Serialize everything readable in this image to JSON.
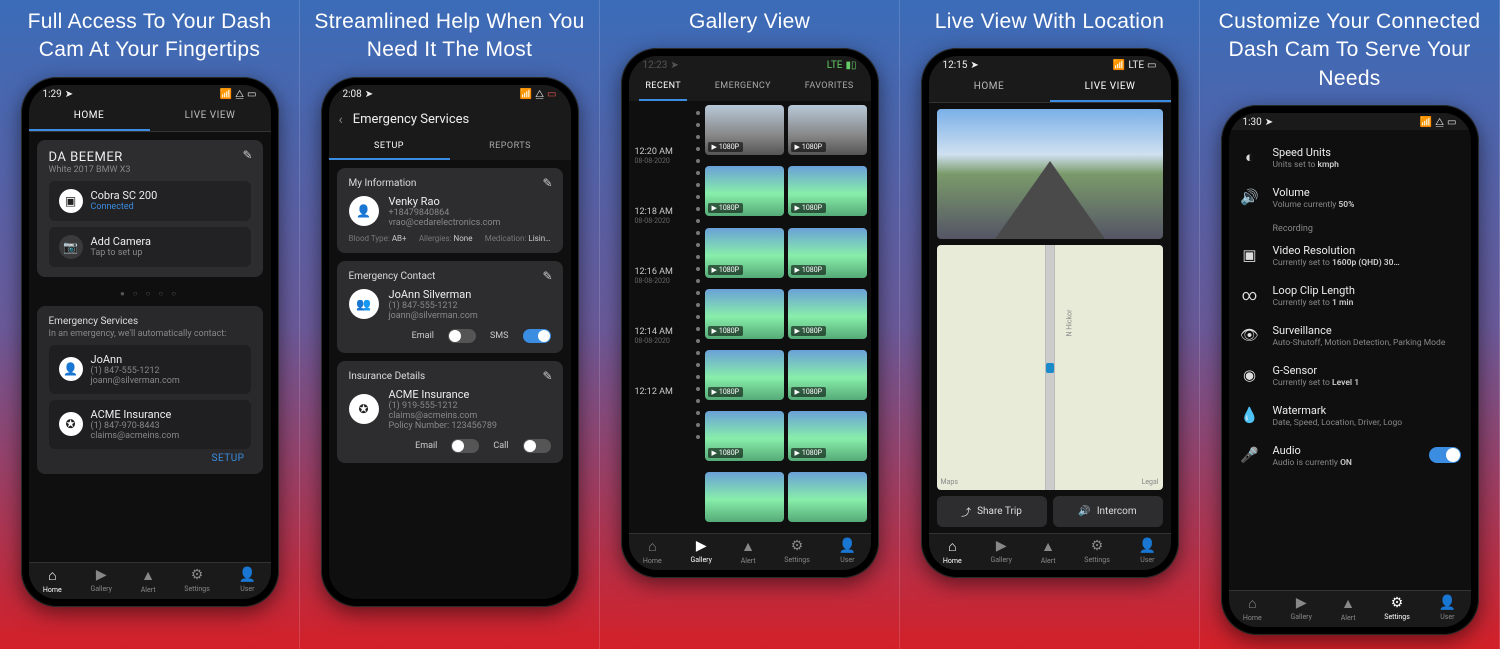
{
  "panels": [
    {
      "title": "Full Access To Your Dash Cam At Your Fingertips"
    },
    {
      "title": "Streamlined Help When You Need It The Most"
    },
    {
      "title": "Gallery View"
    },
    {
      "title": "Live View With Location"
    },
    {
      "title": "Customize Your Connected Dash Cam To Serve Your Needs"
    }
  ],
  "p1": {
    "time": "1:29",
    "tabs": {
      "home": "HOME",
      "live": "LIVE VIEW"
    },
    "vehicle": {
      "name": "DA BEEMER",
      "desc": "White 2017 BMW X3"
    },
    "cam": {
      "name": "Cobra SC 200",
      "status": "Connected"
    },
    "addcam": {
      "title": "Add Camera",
      "sub": "Tap to set up"
    },
    "emerg": {
      "title": "Emergency Services",
      "sub": "In an emergency, we'll automatically contact:",
      "contact1": {
        "name": "JoAnn",
        "phone": "(1) 847-555-1212",
        "email": "joann@silverman.com"
      },
      "contact2": {
        "name": "ACME Insurance",
        "phone": "(1) 847-970-8443",
        "email": "claims@acmeins.com"
      },
      "setup": "SETUP"
    }
  },
  "p2": {
    "time": "2:08",
    "header": "Emergency Services",
    "tabs": {
      "setup": "SETUP",
      "reports": "REPORTS"
    },
    "myinfo": {
      "title": "My Information",
      "name": "Venky Rao",
      "phone": "+18479840864",
      "email": "vrao@cedarelectronics.com",
      "blood_l": "Blood Type:",
      "blood": "AB+",
      "allerg_l": "Allergies:",
      "allerg": "None",
      "med_l": "Medication:",
      "med": "Lisin…"
    },
    "ec": {
      "title": "Emergency Contact",
      "name": "JoAnn Silverman",
      "phone": "(1) 847-555-1212",
      "email": "joann@silverman.com",
      "email_l": "Email",
      "sms_l": "SMS"
    },
    "ins": {
      "title": "Insurance Details",
      "name": "ACME Insurance",
      "phone": "(1) 919-555-1212",
      "email": "claims@acmeins.com",
      "policy_l": "Policy Number:",
      "policy": "123456789",
      "email_l": "Email",
      "call_l": "Call"
    }
  },
  "p3": {
    "time": "12:23",
    "tabs": {
      "recent": "RECENT",
      "emerg": "EMERGENCY",
      "fav": "FAVORITES"
    },
    "date": "08-08-2020",
    "times": [
      "12:20 AM",
      "12:18 AM",
      "12:16 AM",
      "12:14 AM",
      "12:12 AM"
    ],
    "res": "1080P"
  },
  "p4": {
    "time": "12:15",
    "lte": "LTE",
    "tabs": {
      "home": "HOME",
      "live": "LIVE VIEW"
    },
    "maps": "Maps",
    "legal": "Legal",
    "street": "N Hickor",
    "share": "Share Trip",
    "intercom": "Intercom"
  },
  "p5": {
    "time": "1:30",
    "rows": {
      "speed": {
        "t": "Speed Units",
        "s1": "Units set to ",
        "sv": "kmph"
      },
      "vol": {
        "t": "Volume",
        "s1": "Volume currently ",
        "sv": "50%"
      },
      "rec_hdr": "Recording",
      "vres": {
        "t": "Video Resolution",
        "s1": "Currently set to ",
        "sv": "1600p (QHD) 30…"
      },
      "loop": {
        "t": "Loop Clip Length",
        "s1": "Currently set to ",
        "sv": "1 min"
      },
      "surv": {
        "t": "Surveillance",
        "s": "Auto-Shutoff, Motion Detection, Parking Mode"
      },
      "gsen": {
        "t": "G-Sensor",
        "s1": "Currently set to ",
        "sv": "Level 1"
      },
      "wm": {
        "t": "Watermark",
        "s": "Date, Speed, Location, Driver, Logo"
      },
      "audio": {
        "t": "Audio",
        "s1": "Audio is currently ",
        "sv": "ON"
      }
    }
  },
  "nav": {
    "home": "Home",
    "gallery": "Gallery",
    "alert": "Alert",
    "settings": "Settings",
    "user": "User"
  }
}
